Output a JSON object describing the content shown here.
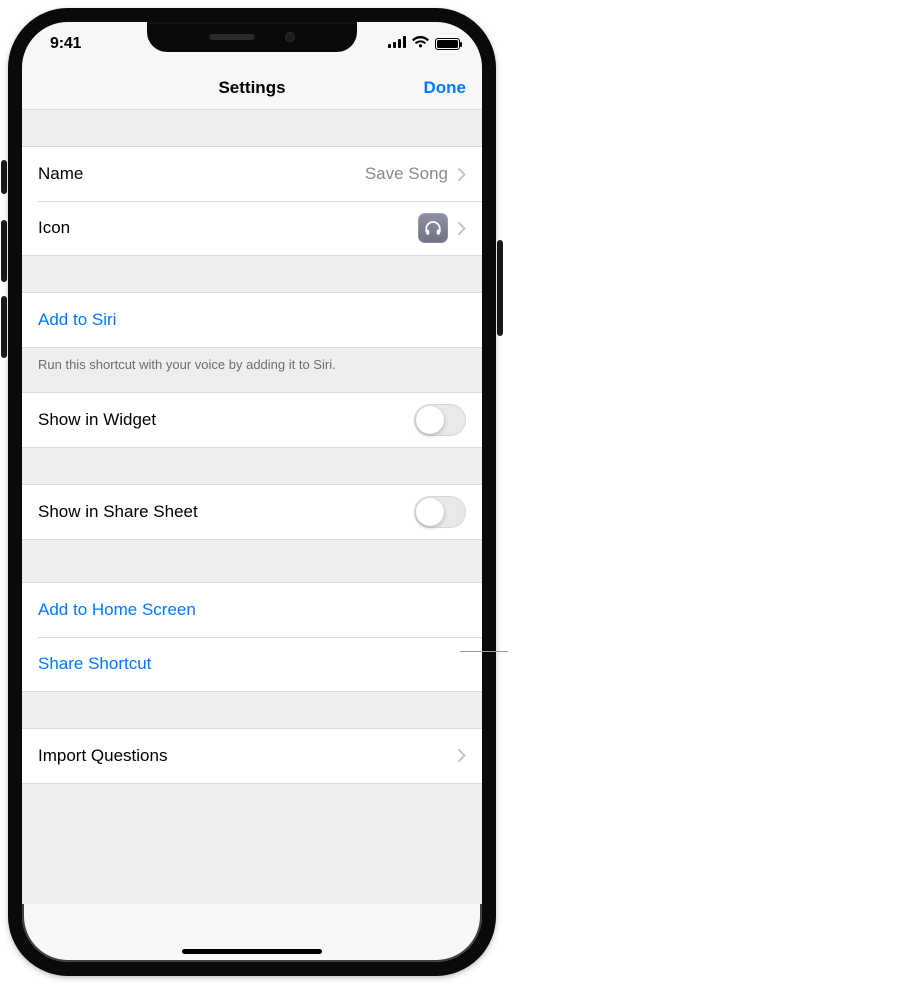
{
  "status": {
    "time": "9:41"
  },
  "nav": {
    "title": "Settings",
    "done": "Done"
  },
  "rows": {
    "name": {
      "label": "Name",
      "value": "Save Song"
    },
    "icon": {
      "label": "Icon",
      "icon_name": "headphones-icon"
    },
    "siri": {
      "label": "Add to Siri"
    },
    "siri_footer": "Run this shortcut with your voice by adding it to Siri.",
    "widget": {
      "label": "Show in Widget",
      "on": false
    },
    "share_sheet": {
      "label": "Show in Share Sheet",
      "on": false
    },
    "home": {
      "label": "Add to Home Screen"
    },
    "share": {
      "label": "Share Shortcut"
    },
    "import": {
      "label": "Import Questions"
    }
  },
  "colors": {
    "link": "#007aff"
  }
}
